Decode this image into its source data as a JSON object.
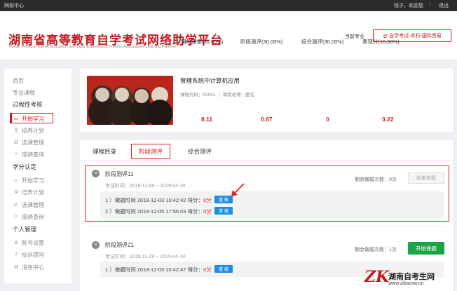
{
  "topbar": {
    "brand": "网校中心",
    "user": "铭子，欢迎您",
    "separator": "|",
    "logout": "退出"
  },
  "header": {
    "title": "湖南省高等教育自学考试网络助学平台",
    "subtitle": "Hunan Province Higher Education Self-study Examination Process Assessment Learning Platform",
    "major_label": "当前专业",
    "major_value": "自学考试-本科-国际贸易"
  },
  "sidebar": {
    "home": "首页",
    "courses": "专业课程",
    "process_section": "过程性考核",
    "process_items": [
      {
        "icon": "monitor-icon",
        "label": "开始学习"
      },
      {
        "icon": "plan-icon",
        "label": "培养计划"
      },
      {
        "icon": "checkbox-icon",
        "label": "选课管理"
      },
      {
        "icon": "search-icon",
        "label": "成绩查询"
      }
    ],
    "credit_section": "学分认定",
    "credit_items": [
      {
        "icon": "monitor-icon",
        "label": "开始学习"
      },
      {
        "icon": "plan-icon",
        "label": "培养计划"
      },
      {
        "icon": "checkbox-icon",
        "label": "选课管理"
      },
      {
        "icon": "search-icon",
        "label": "成绩查询"
      }
    ],
    "personal_section": "个人管理",
    "personal_items": [
      {
        "icon": "user-icon",
        "label": "账号设置"
      },
      {
        "icon": "question-icon",
        "label": "投诉提问"
      },
      {
        "icon": "message-icon",
        "label": "消息中心"
      }
    ]
  },
  "course": {
    "name": "管理系统中计算机应用",
    "meta": "课程代码：00051 ｜ 课程老师：匿名",
    "scores": [
      {
        "label": "网络课堂(30.00%)",
        "value": "8.11"
      },
      {
        "label": "阶段测评(30.00%)",
        "value": "0.67"
      },
      {
        "label": "综合测评(30.00%)",
        "value": "0"
      },
      {
        "label": "表现分(10.00%)",
        "value": "0.22"
      }
    ]
  },
  "tabs": [
    "课程目录",
    "阶段测评",
    "综合测评"
  ],
  "exams": [
    {
      "title": "阶段测评11",
      "time": "考试时间：2018-11-29 ~ 2019-04-19",
      "remain": "剩余做题次数：0次",
      "action": "结束做题",
      "attempts": [
        {
          "prefix": "1 ）做题时间 2018-12-03 10:42:42 得分：",
          "score": "0分",
          "redo": "重 做"
        },
        {
          "prefix": "2 ）做题时间 2018-12-05 17:56:03 得分：",
          "score": "0分",
          "redo": "重 做"
        }
      ]
    },
    {
      "title": "阶段测评21",
      "time": "考试时间：2018-11-29 ~ 2019-04-19",
      "remain": "剩余做题次数：1次",
      "action": "开始做题",
      "attempts": [
        {
          "prefix": "1 ）做题时间 2018-12-03 10:42:47 得分：",
          "score": "0分",
          "redo": "重 做"
        }
      ]
    }
  ],
  "watermark": {
    "logo": "ZK",
    "name": "湖南自考生网",
    "url": "www.zikaosw.cn"
  }
}
